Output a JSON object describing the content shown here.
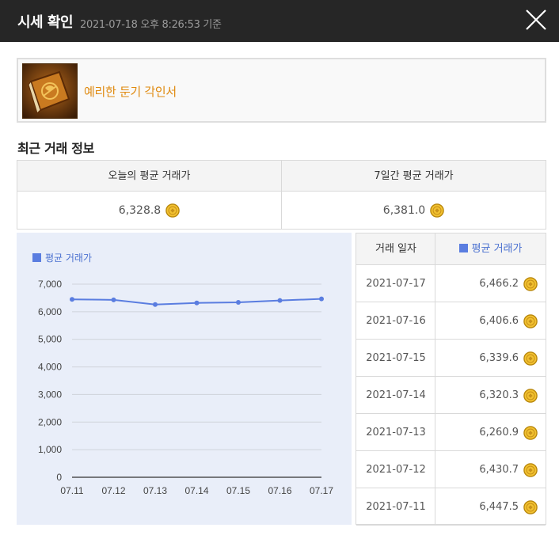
{
  "window": {
    "title": "시세 확인",
    "timestamp": "2021-07-18 오후 8:26:53 기준"
  },
  "item": {
    "name": "예리한 둔기 각인서",
    "name_color": "#e08a10"
  },
  "recent": {
    "section_title": "최근 거래 정보",
    "today_label": "오늘의 평균 거래가",
    "today_value": "6,328.8",
    "week_label": "7일간 평균 거래가",
    "week_value": "6,381.0"
  },
  "history": {
    "date_header": "거래 일자",
    "price_header": "평균 거래가",
    "rows": [
      {
        "date": "2021-07-17",
        "price": "6,466.2"
      },
      {
        "date": "2021-07-16",
        "price": "6,406.6"
      },
      {
        "date": "2021-07-15",
        "price": "6,339.6"
      },
      {
        "date": "2021-07-14",
        "price": "6,320.3"
      },
      {
        "date": "2021-07-13",
        "price": "6,260.9"
      },
      {
        "date": "2021-07-12",
        "price": "6,430.7"
      },
      {
        "date": "2021-07-11",
        "price": "6,447.5"
      }
    ]
  },
  "icons": {
    "close": "close-icon",
    "coin": "gold-coin-icon",
    "item": "engraving-book-icon"
  },
  "colors": {
    "title_bar": "#262626",
    "line": "#5a7de0",
    "chart_bg": "#e9eef9",
    "accent": "#4a70d0"
  },
  "chart_data": {
    "type": "line",
    "legend": "평균 거래가",
    "legend_position": "top-left",
    "grid": true,
    "categories": [
      "07.11",
      "07.12",
      "07.13",
      "07.14",
      "07.15",
      "07.16",
      "07.17"
    ],
    "series": [
      {
        "name": "평균 거래가",
        "values": [
          6447.5,
          6430.7,
          6260.9,
          6320.3,
          6339.6,
          6406.6,
          6466.2
        ]
      }
    ],
    "yticks": [
      "0",
      "1,000",
      "2,000",
      "3,000",
      "4,000",
      "5,000",
      "6,000",
      "7,000"
    ],
    "ylim": [
      0,
      7000
    ]
  }
}
